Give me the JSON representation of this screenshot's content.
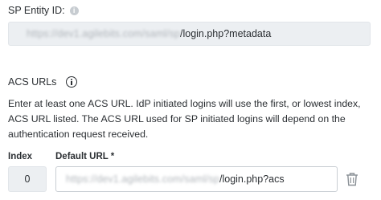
{
  "sp_entity": {
    "label": "SP Entity ID:",
    "info_icon": "info-circle-icon",
    "value_redacted": "https://dev1.agilebits.com/saml/sp",
    "value_suffix": "/login.php?metadata"
  },
  "acs": {
    "title": "ACS URLs",
    "info_icon": "info-circle-outline-icon",
    "description": "Enter at least one ACS URL. IdP initiated logins will use the first, or lowest index, ACS URL listed. The ACS URL used for SP initiated logins will depend on the authentication request received.",
    "columns": {
      "index": "Index",
      "url": "Default URL *"
    },
    "rows": [
      {
        "index": "0",
        "url_redacted": "https://dev1.agilebits.com/saml/sp",
        "url_suffix": "/login.php?acs",
        "delete_icon": "trash-icon"
      }
    ]
  }
}
